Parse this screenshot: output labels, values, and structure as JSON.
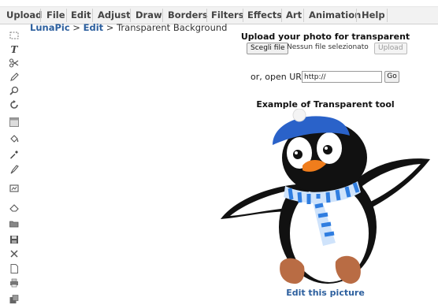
{
  "menu": [
    {
      "label": "Upload"
    },
    {
      "label": "File"
    },
    {
      "label": "Edit"
    },
    {
      "label": "Adjust"
    },
    {
      "label": "Draw"
    },
    {
      "label": "Borders"
    },
    {
      "label": "Filters"
    },
    {
      "label": "Effects"
    },
    {
      "label": "Art"
    },
    {
      "label": "Animation"
    },
    {
      "label": "Help"
    }
  ],
  "breadcrumb": {
    "site": "LunaPic",
    "sep1": " > ",
    "section": "Edit",
    "sep2": " > ",
    "current": "Transparent Background"
  },
  "upload": {
    "title": "Upload your photo for transparent",
    "file_button": "Scegli file",
    "file_status": "Nessun file selezionato",
    "upload_button": "Upload"
  },
  "url": {
    "label": "or, open URL",
    "value": "http://",
    "go_button": "Go"
  },
  "example": {
    "title": "Example of Transparent tool",
    "edit_link": "Edit this picture"
  },
  "tools": [
    "select-icon",
    "text-icon",
    "scissors-icon",
    "pencil-icon",
    "zoom-icon",
    "rotate-icon",
    "crop-icon",
    "paint-bucket-icon",
    "dropper-icon",
    "brush-icon",
    "clone-icon",
    "eraser-icon",
    "open-folder-icon",
    "save-icon",
    "close-icon",
    "new-file-icon",
    "print-icon",
    "copy-icon"
  ],
  "colors": {
    "link": "#2c5f9e",
    "menubar": "#f2f2f2"
  }
}
